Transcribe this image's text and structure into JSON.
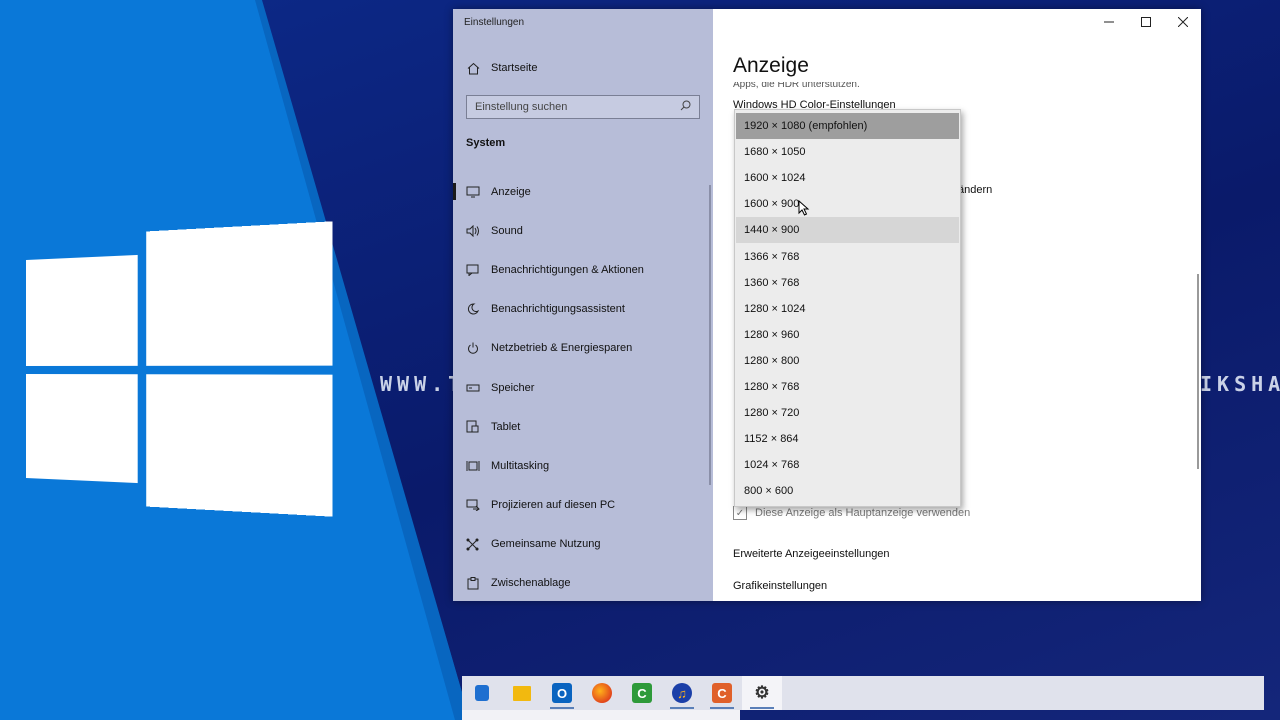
{
  "desktop": {
    "watermark_left": "WWW.TE",
    "watermark_right": "IKSHAV"
  },
  "window": {
    "title": "Einstellungen",
    "controls": {
      "minimize_icon": "minimize-icon",
      "maximize_icon": "maximize-icon",
      "close_icon": "close-icon"
    }
  },
  "sidebar": {
    "home_label": "Startseite",
    "search_placeholder": "Einstellung suchen",
    "section_title": "System",
    "items": [
      {
        "label": "Anzeige",
        "icon": "monitor-icon",
        "active": true
      },
      {
        "label": "Sound",
        "icon": "speaker-icon"
      },
      {
        "label": "Benachrichtigungen & Aktionen",
        "icon": "notification-icon"
      },
      {
        "label": "Benachrichtigungsassistent",
        "icon": "moon-icon"
      },
      {
        "label": "Netzbetrieb & Energiesparen",
        "icon": "power-icon"
      },
      {
        "label": "Speicher",
        "icon": "storage-icon"
      },
      {
        "label": "Tablet",
        "icon": "tablet-icon"
      },
      {
        "label": "Multitasking",
        "icon": "multitasking-icon"
      },
      {
        "label": "Projizieren auf diesen PC",
        "icon": "project-icon"
      },
      {
        "label": "Gemeinsame Nutzung",
        "icon": "share-icon"
      },
      {
        "label": "Zwischenablage",
        "icon": "clipboard-icon"
      }
    ]
  },
  "content": {
    "title": "Anzeige",
    "clipped_line": "Apps, die HDR unterstützen.",
    "hd_color_link": "Windows HD Color-Einstellungen",
    "partial_text": "ändern",
    "main_display_checkbox": "Diese Anzeige als Hauptanzeige verwenden",
    "advanced_link": "Erweiterte Anzeigeeinstellungen",
    "graphics_link": "Grafikeinstellungen"
  },
  "resolution_dropdown": {
    "selected": "1920 × 1080 (empfohlen)",
    "hovered": "1440 × 900",
    "options": [
      "1920 × 1080 (empfohlen)",
      "1680 × 1050",
      "1600 × 1024",
      "1600 × 900",
      "1440 × 900",
      "1366 × 768",
      "1360 × 768",
      "1280 × 1024",
      "1280 × 960",
      "1280 × 800",
      "1280 × 768",
      "1280 × 720",
      "1152 × 864",
      "1024 × 768",
      "800 × 600"
    ]
  },
  "taskbar": {
    "apps": [
      {
        "name": "mail-app-icon",
        "color": "#1e6fd0",
        "glyph": ""
      },
      {
        "name": "file-explorer-icon",
        "color": "#f2b90f",
        "glyph": ""
      },
      {
        "name": "outlook-icon",
        "color": "#0a64c0",
        "glyph": "O"
      },
      {
        "name": "firefox-icon",
        "color": "#ff7b1a",
        "glyph": ""
      },
      {
        "name": "camtasia-icon",
        "color": "#2e9a3a",
        "glyph": "C"
      },
      {
        "name": "audacity-icon",
        "color": "#1b3fa8",
        "glyph": "♫"
      },
      {
        "name": "camtasia-recorder-icon",
        "color": "#e0602a",
        "glyph": "C"
      },
      {
        "name": "settings-icon",
        "color": "#333333",
        "glyph": "⚙"
      }
    ]
  }
}
